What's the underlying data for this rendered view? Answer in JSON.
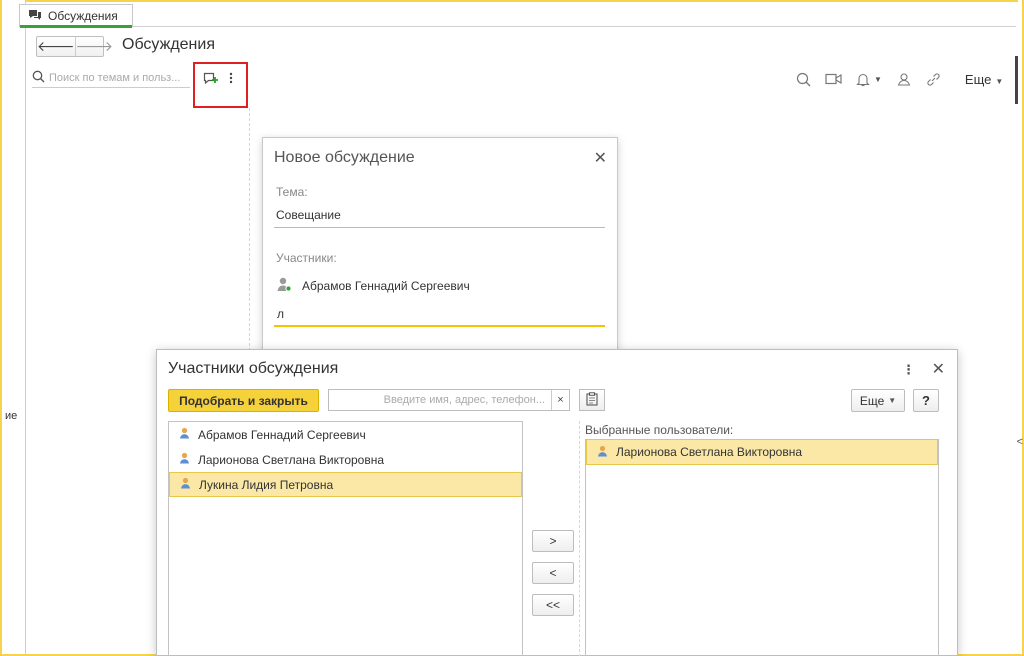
{
  "left_fragment": "ие",
  "right_fragment": "<",
  "tab": {
    "label": "Обсуждения"
  },
  "page": {
    "title": "Обсуждения"
  },
  "search": {
    "placeholder": "Поиск по темам и польз..."
  },
  "toolbar": {
    "more_label": "Еще"
  },
  "new_discussion": {
    "title": "Новое обсуждение",
    "topic_label": "Тема:",
    "topic_value": "Совещание",
    "participants_label": "Участники:",
    "participant": "Абрамов Геннадий Сергеевич",
    "participant_input_value": "л"
  },
  "participants_dialog": {
    "title": "Участники обсуждения",
    "pick_close_label": "Подобрать и закрыть",
    "search_placeholder": "Введите имя, адрес, телефон...",
    "clear_label": "×",
    "more_label": "Еще",
    "help_label": "?",
    "users": [
      {
        "name": "Абрамов Геннадий Сергеевич",
        "selected": false
      },
      {
        "name": "Ларионова Светлана Викторовна",
        "selected": false
      },
      {
        "name": "Лукина Лидия Петровна",
        "selected": true
      }
    ],
    "move_right_label": ">",
    "move_left_label": "<",
    "move_all_left_label": "<<",
    "selected_users_label": "Выбранные пользователи:",
    "selected_users": [
      {
        "name": "Ларионова Светлана Викторовна"
      }
    ]
  },
  "colors": {
    "accent_yellow": "#f5d13a",
    "selection": "#fbe8a6",
    "highlight_red": "#e02020",
    "tab_green": "#3aa13a"
  }
}
